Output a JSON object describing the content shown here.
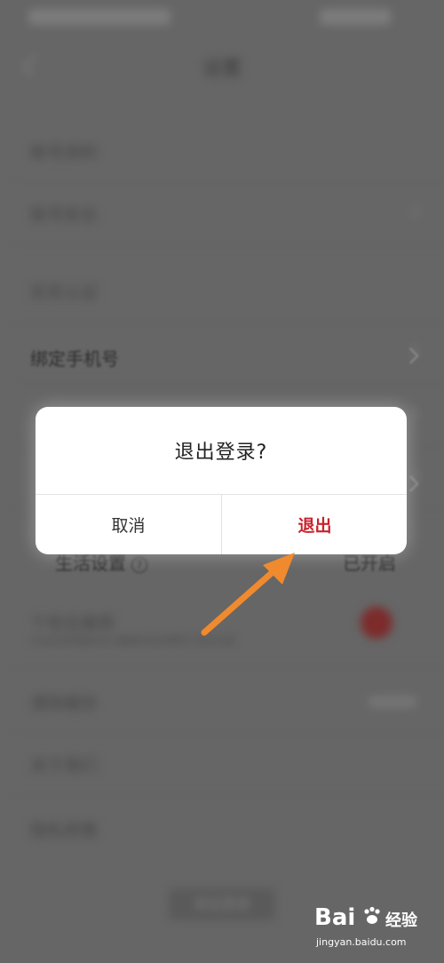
{
  "background": {
    "nav_title": "设置",
    "rows": [
      {
        "label": "账号资料",
        "value": ""
      },
      {
        "label": "账号安全",
        "value": ""
      },
      {
        "label": "实名认证",
        "value": ""
      },
      {
        "label": "绑定手机号",
        "value": ""
      },
      {
        "label": "",
        "value": ""
      },
      {
        "label": "",
        "value": ""
      },
      {
        "label": "生活设置",
        "value": "已开启"
      },
      {
        "label": "个性化推荐",
        "value": "",
        "subtext": "开启后将根据你的兴趣爱好向你推荐个性化内容"
      },
      {
        "label": "清除缓存",
        "value": ""
      },
      {
        "label": "关于我们",
        "value": ""
      },
      {
        "label": "隐私政策",
        "value": ""
      }
    ],
    "bottom_button": "退出登录"
  },
  "foreground_peek": {
    "phone_label": "绑定手机号",
    "life_settings_label": "生活设置",
    "life_settings_value": "已开启",
    "help_glyph": "?"
  },
  "dialog": {
    "title": "退出登录?",
    "cancel_label": "取消",
    "confirm_label": "退出"
  },
  "annotation": {
    "arrow_color": "#f08a2e"
  },
  "watermark": {
    "brand": "Bai",
    "brand_suffix": "经验",
    "url": "jingyan.baidu.com"
  }
}
